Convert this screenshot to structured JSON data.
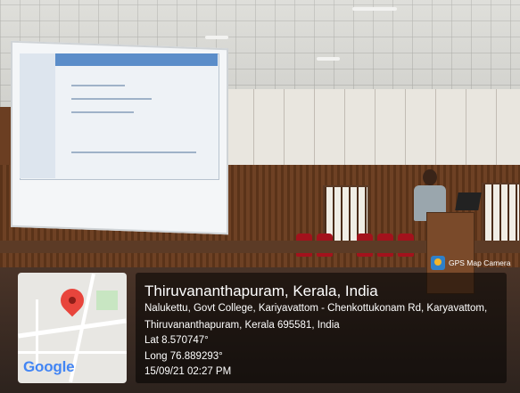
{
  "overlay": {
    "location_title": "Thiruvananthapuram, Kerala, India",
    "address_line1": "Nalukettu, Govt College, Kariyavattom - Chenkottukonam Rd, Karyavattom,",
    "address_line2": "Thiruvananthapuram, Kerala 695581, India",
    "latitude": "Lat 8.570747°",
    "longitude": "Long 76.889293°",
    "datetime": "15/09/21 02:27 PM",
    "app_label": "GPS Map Camera",
    "map_logo": "Google"
  },
  "colors": {
    "pin": "#e8453c",
    "google_logo": "#4285f4",
    "overlay_bg": "rgba(0,0,0,0.52)"
  },
  "icons": [
    "map-pin-icon",
    "gps-map-camera-icon"
  ]
}
